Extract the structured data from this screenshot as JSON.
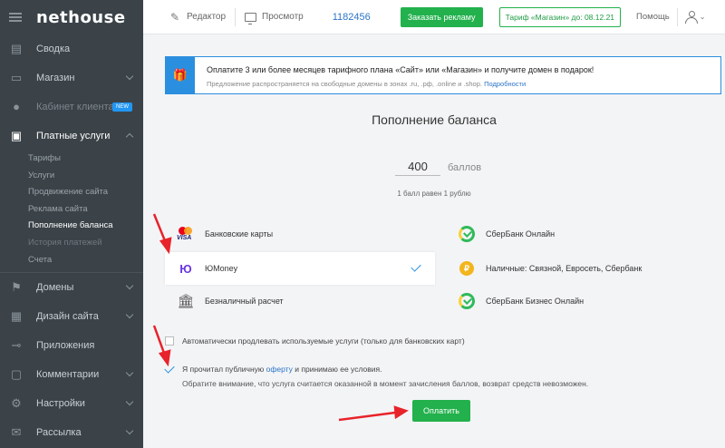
{
  "sidebar": {
    "logo": "nethouse",
    "items": [
      {
        "label": "Сводка",
        "icon": "dashboard-icon"
      },
      {
        "label": "Магазин",
        "icon": "shop-icon"
      },
      {
        "label": "Кабинет клиента",
        "icon": "users-icon",
        "badge": "NEW"
      },
      {
        "label": "Платные услуги",
        "icon": "wallet-icon"
      },
      {
        "label": "Домены",
        "icon": "flag-icon"
      },
      {
        "label": "Дизайн сайта",
        "icon": "layout-icon"
      },
      {
        "label": "Приложения",
        "icon": "plug-icon"
      },
      {
        "label": "Комментарии",
        "icon": "comment-icon"
      },
      {
        "label": "Настройки",
        "icon": "gear-icon"
      },
      {
        "label": "Рассылка",
        "icon": "mail-icon"
      }
    ],
    "subitems": [
      "Тарифы",
      "Услуги",
      "Продвижение сайта",
      "Реклама сайта",
      "Пополнение баланса",
      "История платежей",
      "Счета"
    ]
  },
  "topbar": {
    "editor": "Редактор",
    "preview": "Просмотр",
    "site_id": "1182456",
    "order_ad": "Заказать рекламу",
    "tariff": "Тариф «Магазин» до: 08.12.21",
    "help": "Помощь"
  },
  "banner": {
    "text": "Оплатите 3 или более месяцев тарифного плана «Сайт» или «Магазин» и получите домен в подарок!",
    "small": "Предложение распространяется на свободные домены в зонах .ru, .рф, .online и .shop.",
    "link": "Подробности"
  },
  "main": {
    "title": "Пополнение баланса",
    "amount": "400",
    "unit": "баллов",
    "rate": "1 балл равен 1 рублю"
  },
  "methods": {
    "cards": "Банковские карты",
    "yoomoney": "ЮMoney",
    "cashless": "Безналичный расчет",
    "sber_online": "СберБанк Онлайн",
    "cash": "Наличные: Связной, Евросеть, Сбербанк",
    "sber_business": "СберБанк Бизнес Онлайн",
    "yoomoney_logo": "Ю"
  },
  "options": {
    "autorenew": "Автоматически продлевать используемые услуги (только для банковских карт)",
    "agree_pre": "Я прочитал публичную",
    "agree_link": "оферту",
    "agree_post": "и принимаю ее условия.",
    "note": "Обратите внимание, что услуга считается оказанной в момент зачисления баллов, возврат средств невозможен."
  },
  "pay_button": "Оплатить",
  "colors": {
    "accent_green": "#22b14c",
    "link_blue": "#2b74c7",
    "arrow_red": "#e8232a"
  }
}
